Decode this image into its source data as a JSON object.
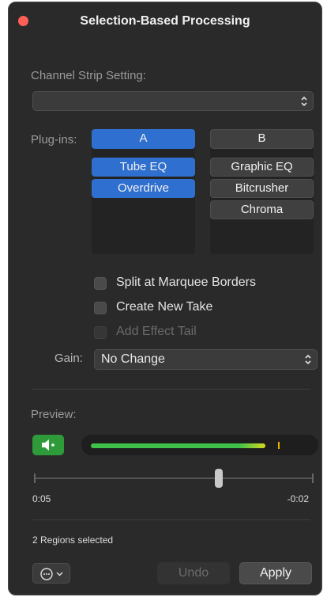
{
  "window": {
    "title": "Selection-Based Processing"
  },
  "channel_strip": {
    "label": "Channel Strip Setting:",
    "value": ""
  },
  "plugins": {
    "label": "Plug-ins:",
    "column_a": {
      "header": "A",
      "items": [
        "Tube EQ",
        "Overdrive"
      ]
    },
    "column_b": {
      "header": "B",
      "items": [
        "Graphic EQ",
        "Bitcrusher",
        "Chroma"
      ]
    }
  },
  "options": {
    "split_at_marquee_borders": {
      "label": "Split at Marquee Borders",
      "checked": false,
      "enabled": true
    },
    "create_new_take": {
      "label": "Create New Take",
      "checked": false,
      "enabled": true
    },
    "add_effect_tail": {
      "label": "Add Effect Tail",
      "checked": false,
      "enabled": false
    }
  },
  "gain": {
    "label": "Gain:",
    "value": "No Change"
  },
  "preview": {
    "label": "Preview:",
    "level_fraction": 0.8,
    "peak_fraction": 0.86,
    "position_fraction": 0.66,
    "time_elapsed": "0:05",
    "time_remaining": "-0:02"
  },
  "status": {
    "text": "2 Regions selected"
  },
  "buttons": {
    "undo": "Undo",
    "apply": "Apply"
  },
  "icons": {
    "close": "close-icon",
    "more": "ellipsis-circle-icon",
    "speaker": "speaker-icon",
    "updown": "chevron-updown-icon"
  },
  "colors": {
    "accent_blue": "#2e6fcf",
    "preview_green": "#2e9a3a",
    "close_red": "#ff5f57"
  }
}
